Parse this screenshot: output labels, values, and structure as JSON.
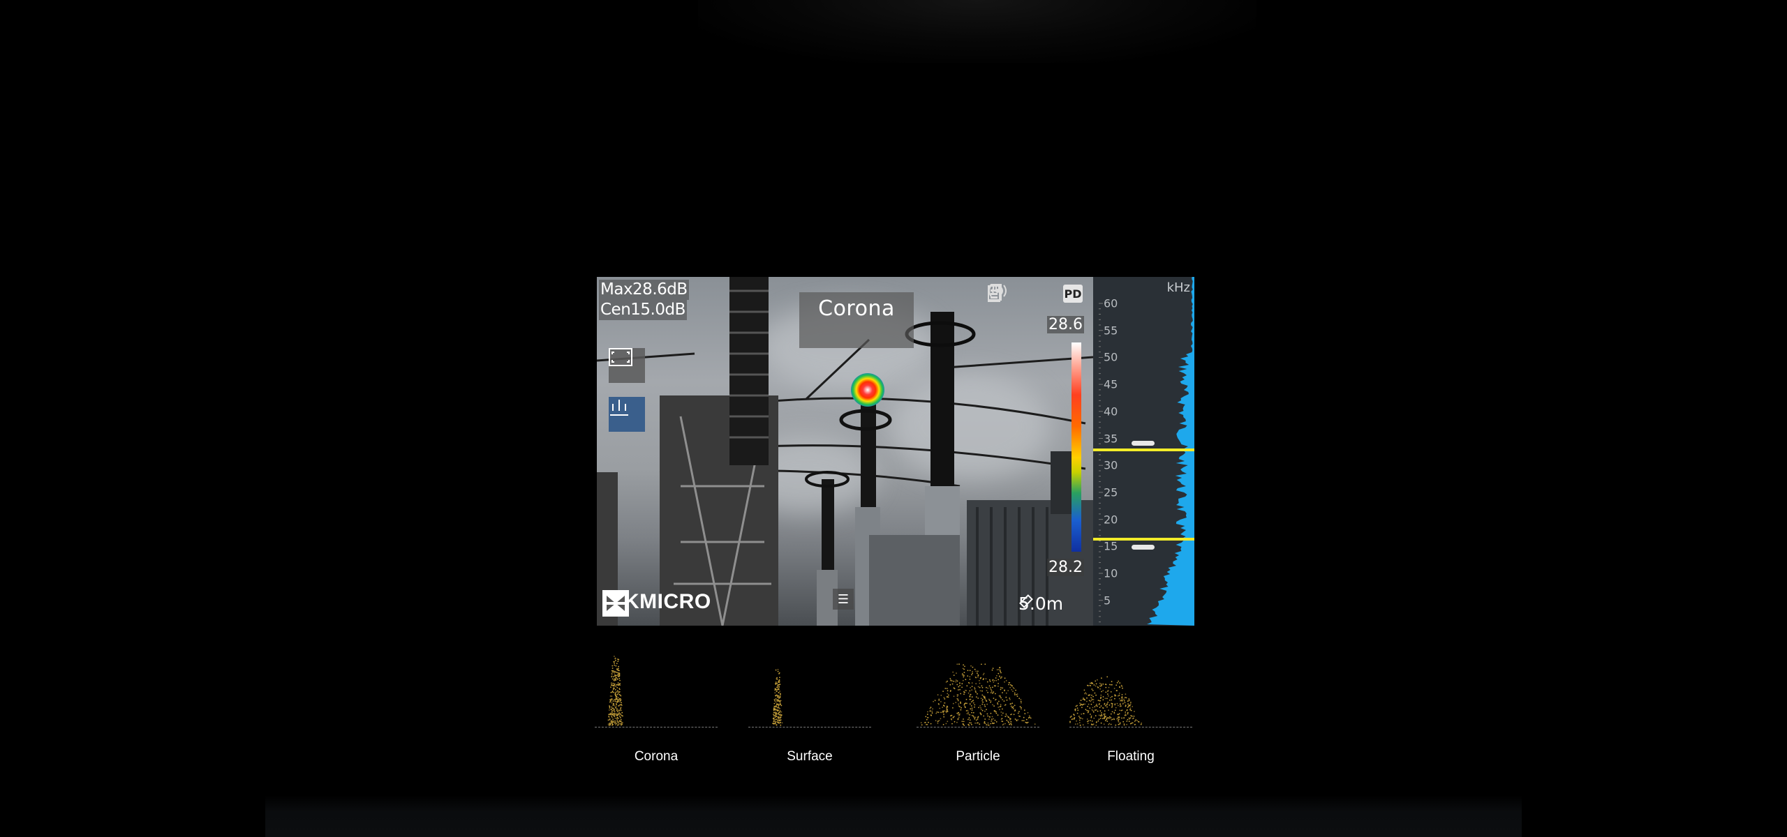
{
  "readouts": {
    "max": "Max28.6dB",
    "cen": "Cen15.0dB"
  },
  "mode": {
    "label": "Corona"
  },
  "status": {
    "badge": "PD",
    "icons": [
      "signal-icon",
      "sd-card-icon",
      "battery-icon",
      "pd-badge"
    ]
  },
  "scale": {
    "max": "28.6",
    "min": "28.2"
  },
  "branding": {
    "logo_text": "HIKMICRO"
  },
  "distance": {
    "value": "5.0m"
  },
  "spectrum": {
    "unit": "kHz",
    "ticks": [
      "60",
      "55",
      "50",
      "45",
      "40",
      "35",
      "30",
      "25",
      "20",
      "15",
      "10",
      "5"
    ],
    "band_upper_khz": 35,
    "band_lower_khz": 15,
    "line_color": "#f2ec2a",
    "fill_color": "#1ea8ec"
  },
  "patterns": [
    {
      "label": "Corona"
    },
    {
      "label": "Surface"
    },
    {
      "label": "Particle"
    },
    {
      "label": "Floating"
    }
  ]
}
